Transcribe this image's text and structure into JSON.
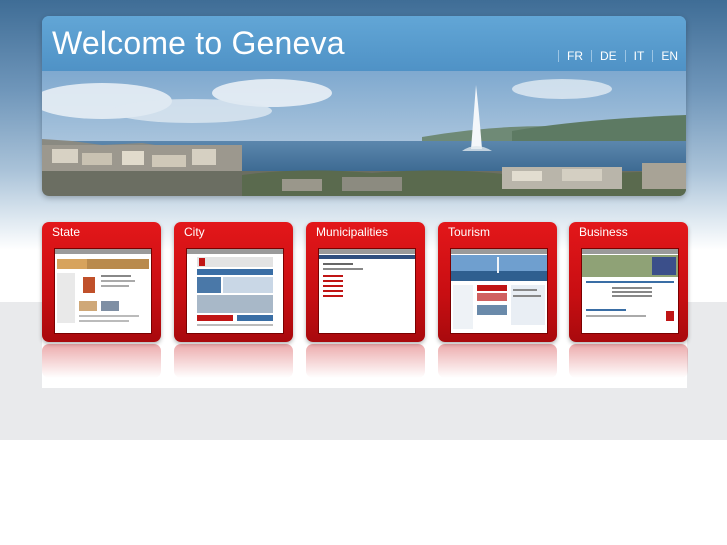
{
  "header": {
    "title": "Welcome to Geneva",
    "languages": [
      "FR",
      "DE",
      "IT",
      "EN"
    ]
  },
  "sections": [
    {
      "label": "State"
    },
    {
      "label": "City"
    },
    {
      "label": "Municipalities"
    },
    {
      "label": "Tourism"
    },
    {
      "label": "Business"
    }
  ],
  "colors": {
    "header_blue": "#5496c8",
    "card_red": "#d01015",
    "page_grey": "#e9eaec"
  }
}
